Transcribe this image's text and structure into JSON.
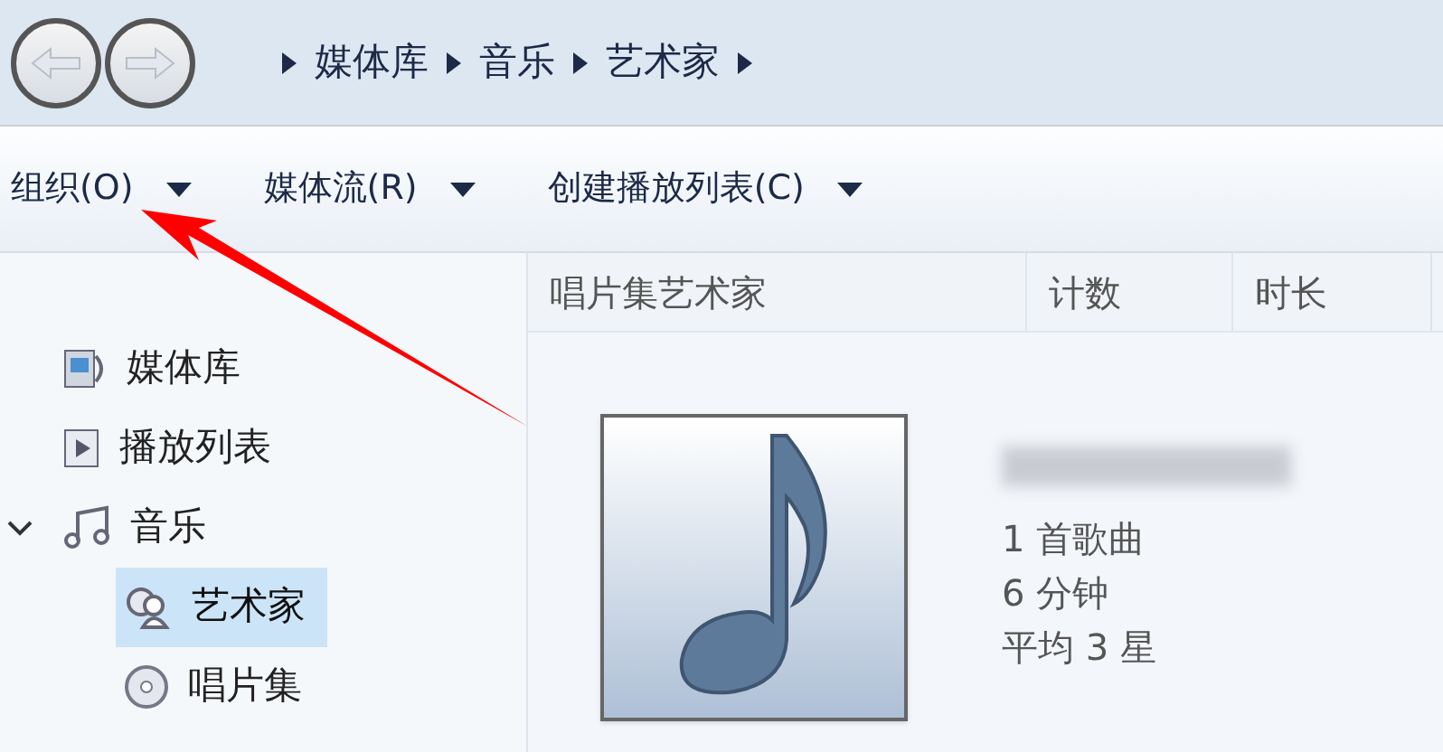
{
  "breadcrumb": [
    "媒体库",
    "音乐",
    "艺术家"
  ],
  "toolbar": [
    {
      "label": "组织(O)"
    },
    {
      "label": "媒体流(R)"
    },
    {
      "label": "创建播放列表(C)"
    }
  ],
  "sidebar": {
    "items": [
      {
        "label": "媒体库",
        "kind": "library",
        "selected": false
      },
      {
        "label": "播放列表",
        "kind": "playlist",
        "selected": false
      },
      {
        "label": "音乐",
        "kind": "music",
        "selected": false,
        "expanded": true,
        "children": [
          {
            "label": "艺术家",
            "kind": "artist",
            "selected": true
          },
          {
            "label": "唱片集",
            "kind": "album",
            "selected": false
          }
        ]
      }
    ]
  },
  "table": {
    "columns": [
      "唱片集艺术家",
      "计数",
      "时长"
    ]
  },
  "artist_tile": {
    "song_count": "1 首歌曲",
    "duration": "6 分钟",
    "rating": "平均 3 星"
  }
}
